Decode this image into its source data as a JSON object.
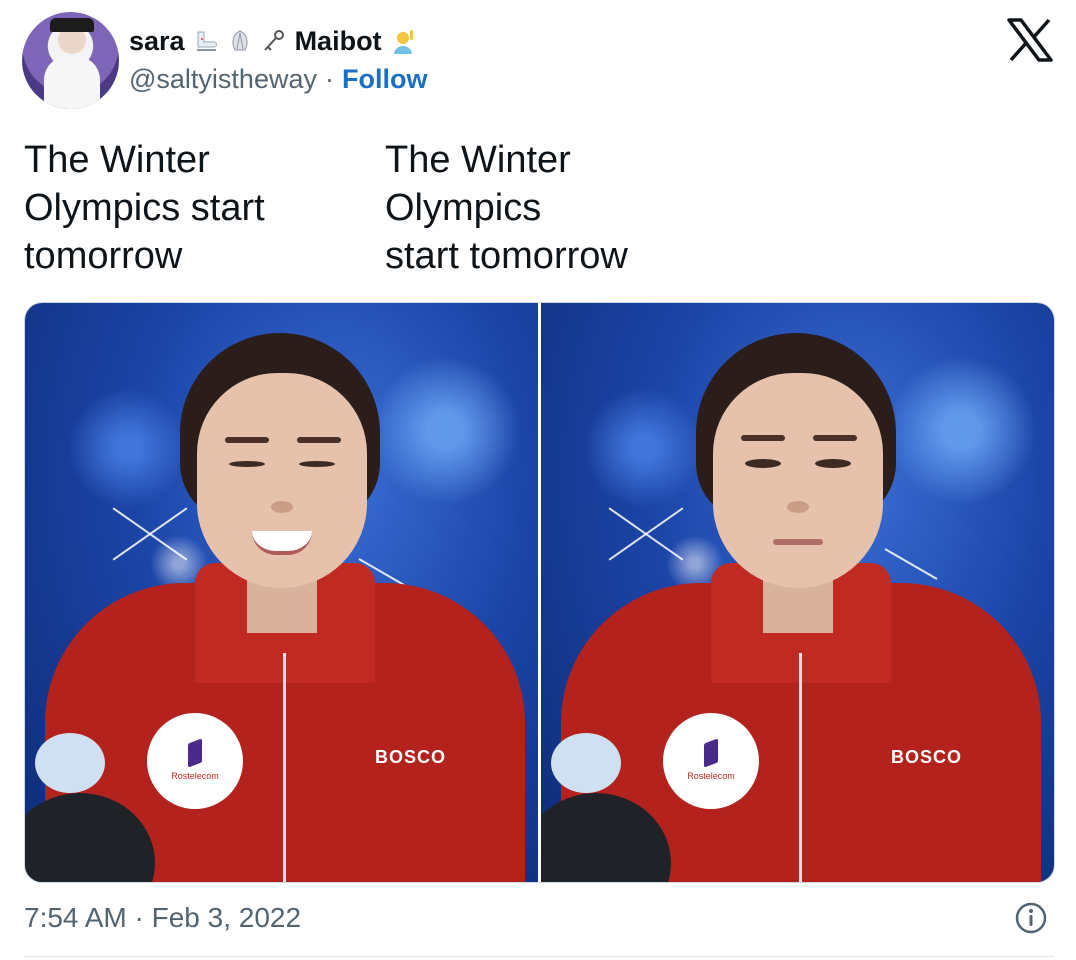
{
  "user": {
    "display_name": "sara",
    "display_name_suffix": "Maibot",
    "handle": "@saltyistheway",
    "separator": "·",
    "follow_label": "Follow",
    "emojis": [
      "ice-skate-icon",
      "shell-icon",
      "key-icon",
      "person-raising-hand-icon"
    ]
  },
  "tweet": {
    "text_left": "The Winter\nOlympics start\ntomorrow",
    "text_right": "The Winter\nOlympics\nstart tomorrow"
  },
  "media": {
    "left_image": {
      "badge_text": "Rostelecom",
      "brand_text": "BOSCO"
    },
    "right_image": {
      "badge_text": "Rostelecom",
      "brand_text": "BOSCO"
    }
  },
  "footer": {
    "timestamp": "7:54 AM · Feb 3, 2022"
  },
  "icons": {
    "logo": "x-logo-icon",
    "info": "info-icon"
  },
  "colors": {
    "link": "#1d6fc1",
    "secondary_text": "#536471",
    "jacket": "#b3221d"
  }
}
